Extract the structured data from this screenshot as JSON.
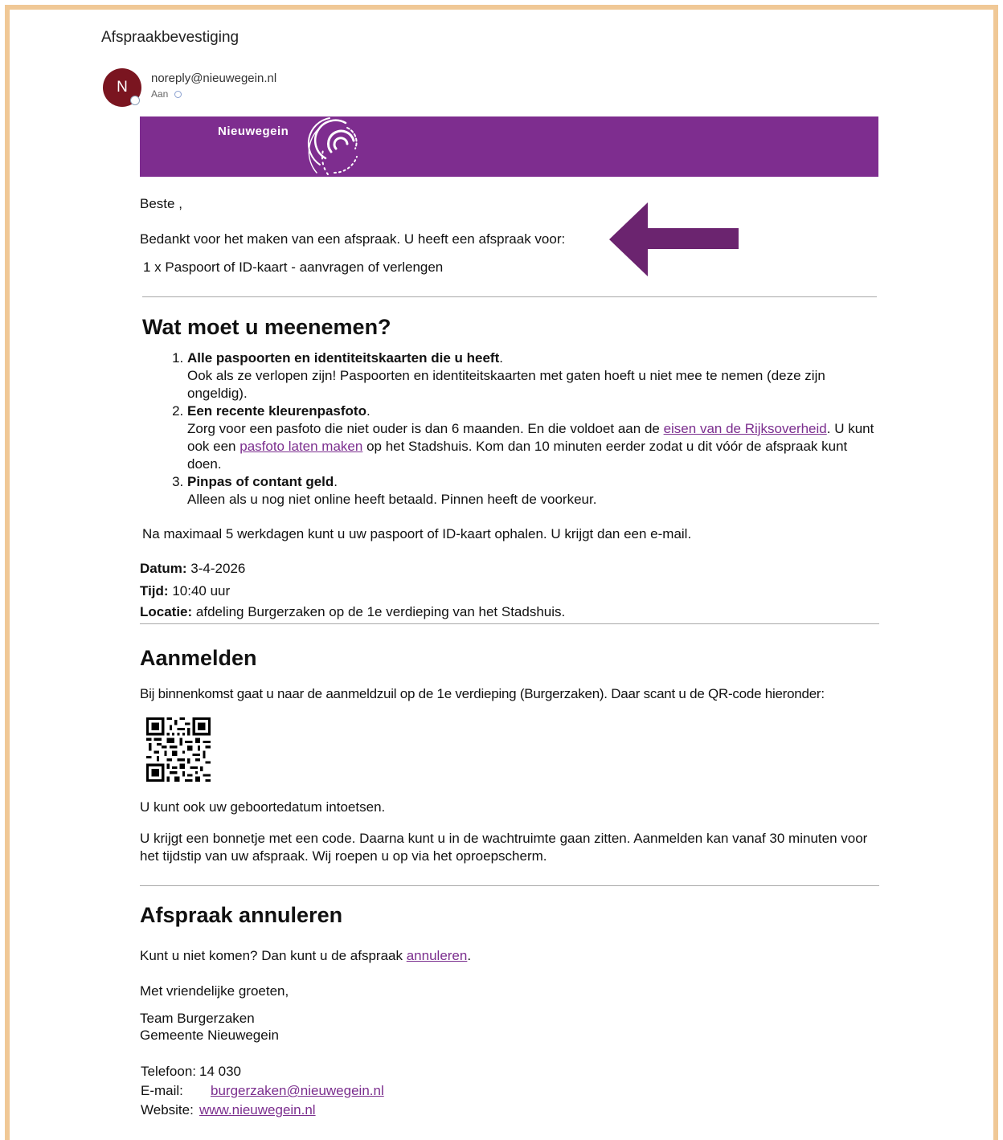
{
  "email": {
    "subject": "Afspraakbevestiging",
    "avatar_initial": "N",
    "sender": "noreply@nieuwegein.nl",
    "to_label": "Aan"
  },
  "banner": {
    "brand_name": "Nieuwegein",
    "background_color": "#7e2d8f"
  },
  "body": {
    "greeting": "Beste ,",
    "thanks": "Bedankt voor het maken van een afspraak. U heeft een afspraak voor:",
    "appointment_type": "1 x Paspoort of ID-kaart - aanvragen of verlengen",
    "annotation_arrow_color": "#6b246f"
  },
  "bring": {
    "title": "Wat moet u meenemen?",
    "items": [
      {
        "heading": "Alle paspoorten en identiteitskaarten die u heeft",
        "text": "Ook als ze verlopen zijn! Paspoorten en identiteitskaarten met gaten hoeft u niet mee te nemen (deze zijn ongeldig)."
      },
      {
        "heading": "Een recente kleurenpasfoto",
        "text_a": "Zorg voor een pasfoto die niet ouder is dan 6 maanden. En die voldoet aan de ",
        "link_a": "eisen van de Rijksoverheid",
        "text_b": ". U kunt ook een ",
        "link_b": "pasfoto laten maken",
        "text_c": " op het Stadshuis. Kom dan 10 minuten eerder zodat u dit vóór de afspraak kunt doen."
      },
      {
        "heading": "Pinpas of contant geld",
        "text": "Alleen als u nog niet online heeft betaald. Pinnen heeft de voorkeur."
      }
    ],
    "pickup_note": "Na maximaal 5 werkdagen kunt u uw paspoort of ID-kaart ophalen. U krijgt dan een e-mail."
  },
  "details": {
    "date_label": "Datum:",
    "date_value": "3-4-2026",
    "time_label": "Tijd:",
    "time_value": "10:40 uur",
    "location_label": "Locatie:",
    "location_value": "afdeling Burgerzaken op de 1e verdieping van het Stadshuis."
  },
  "checkin": {
    "title": "Aanmelden",
    "instruction": "Bij binnenkomst gaat u naar de aanmeldzuil op de 1e verdieping (Burgerzaken). Daar scant u de QR-code hieronder:",
    "birthdate_note": "U kunt ook uw geboortedatum intoetsen.",
    "receipt_note": "U krijgt een bonnetje met een code. Daarna kunt u in de wachtruimte gaan zitten. Aanmelden kan vanaf 30 minuten voor het tijdstip van uw afspraak. Wij roepen u op via het oproepscherm."
  },
  "cancel": {
    "title": "Afspraak annuleren",
    "text_before": "Kunt u niet komen? Dan kunt u de afspraak ",
    "link": "annuleren",
    "text_after": "."
  },
  "closing": {
    "regards": "Met vriendelijke groeten,",
    "team": "Team Burgerzaken",
    "org": "Gemeente Nieuwegein",
    "phone_label": "Telefoon:",
    "phone_value": "14 030",
    "email_label": "E-mail:",
    "email_value": "burgerzaken@nieuwegein.nl",
    "website_label": "Website:",
    "website_value": "www.nieuwegein.nl"
  }
}
